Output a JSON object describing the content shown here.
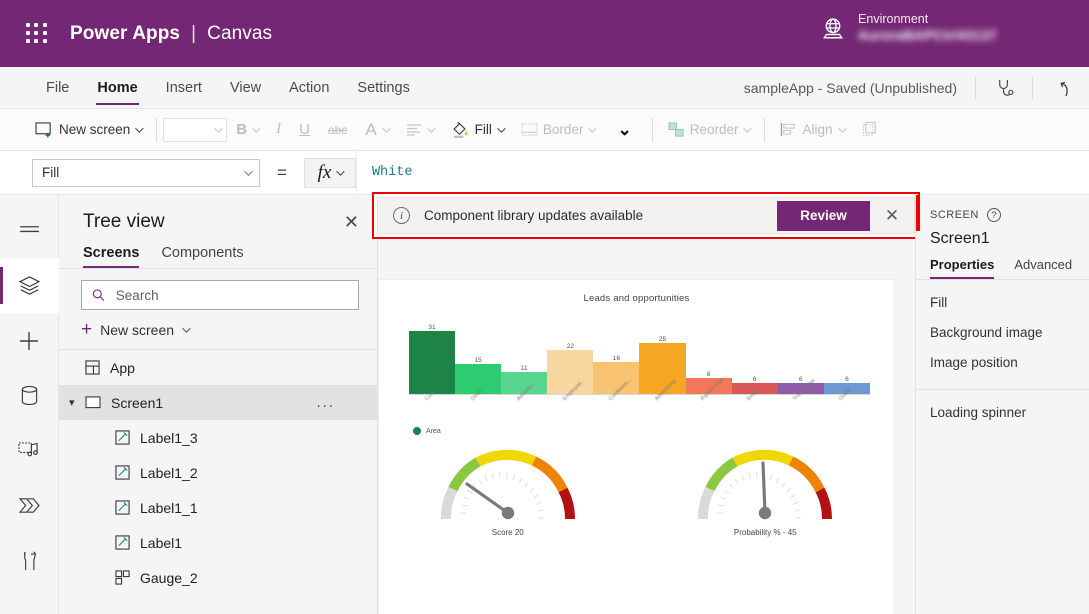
{
  "topbar": {
    "waffle_icon": "waffle-grid-icon",
    "brand": "Power Apps",
    "divider": "|",
    "product": "Canvas",
    "globe_icon": "globe-icon",
    "env_label": "Environment",
    "env_name": "AuroraBAPCtrl43137"
  },
  "menu": {
    "items": [
      {
        "label": "File",
        "active": false
      },
      {
        "label": "Home",
        "active": true
      },
      {
        "label": "Insert",
        "active": false
      },
      {
        "label": "View",
        "active": false
      },
      {
        "label": "Action",
        "active": false
      },
      {
        "label": "Settings",
        "active": false
      }
    ],
    "app_status": "sampleApp - Saved (Unpublished)",
    "checker_icon": "app-checker-stethoscope-icon",
    "undo_icon": "undo-arrow-icon"
  },
  "ribbon": {
    "new_screen": "New screen",
    "new_screen_icon": "new-screen-icon",
    "font_placeholder": "",
    "bold": "B",
    "italic": "I",
    "underline": "U",
    "strikethrough": "abc",
    "font_color_icon": "font-color-A-icon",
    "align_icon": "text-align-icon",
    "fill_icon": "fill-paint-bucket-icon",
    "fill": "Fill",
    "border_icon": "border-icon",
    "border": "Border",
    "overflow_chevron_icon": "chevron-down-icon",
    "reorder_icon": "reorder-icon",
    "reorder": "Reorder",
    "align_group_icon": "align-objects-icon",
    "align": "Align",
    "group_icon": "group-objects-icon"
  },
  "formula": {
    "property": "Fill",
    "equals": "=",
    "fx": "fx",
    "value": "White"
  },
  "rail": {
    "items": [
      {
        "icon": "hamburger-menu-icon",
        "active": false
      },
      {
        "icon": "tree-view-layers-icon",
        "active": true
      },
      {
        "icon": "insert-plus-icon",
        "active": false
      },
      {
        "icon": "data-database-icon",
        "active": false
      },
      {
        "icon": "media-icon",
        "active": false
      },
      {
        "icon": "power-automate-flow-icon",
        "active": false
      },
      {
        "icon": "variables-tools-icon",
        "active": false
      }
    ]
  },
  "treeview": {
    "title": "Tree view",
    "close_icon": "close-x-icon",
    "tabs": [
      {
        "label": "Screens",
        "active": true
      },
      {
        "label": "Components",
        "active": false
      }
    ],
    "search_icon": "search-icon",
    "search_placeholder": "Search",
    "search_value": "",
    "new_screen": "New screen",
    "new_screen_plus_icon": "plus-icon",
    "new_screen_chevron_icon": "chevron-down-icon",
    "items": [
      {
        "label": "App",
        "icon": "app-icon",
        "indent": false,
        "selected": false,
        "caret": "",
        "overflow": ""
      },
      {
        "label": "Screen1",
        "icon": "screen-icon",
        "indent": false,
        "selected": true,
        "caret": "chevron-down-icon",
        "overflow": "..."
      },
      {
        "label": "Label1_3",
        "icon": "label-icon",
        "indent": true,
        "selected": false,
        "caret": "",
        "overflow": ""
      },
      {
        "label": "Label1_2",
        "icon": "label-icon",
        "indent": true,
        "selected": false,
        "caret": "",
        "overflow": ""
      },
      {
        "label": "Label1_1",
        "icon": "label-icon",
        "indent": true,
        "selected": false,
        "caret": "",
        "overflow": ""
      },
      {
        "label": "Label1",
        "icon": "label-icon",
        "indent": true,
        "selected": false,
        "caret": "",
        "overflow": ""
      },
      {
        "label": "Gauge_2",
        "icon": "gauge-component-icon",
        "indent": true,
        "selected": false,
        "caret": "",
        "overflow": ""
      }
    ]
  },
  "notification": {
    "info_icon": "info-circle-icon",
    "message": "Component library updates available",
    "review_label": "Review",
    "close_icon": "close-x-icon",
    "highlight_color": "#ee0000",
    "button_color": "#742774"
  },
  "properties": {
    "kind": "SCREEN",
    "help_icon": "help-question-icon",
    "name": "Screen1",
    "tabs": [
      {
        "label": "Properties",
        "active": true
      },
      {
        "label": "Advanced",
        "active": false
      }
    ],
    "rows": [
      "Fill",
      "Background image",
      "Image position"
    ],
    "rows2": [
      "Loading spinner"
    ]
  },
  "chart_data": {
    "type": "bar",
    "title": "Leads and opportunities",
    "categories": [
      "Cold",
      "Deals",
      "Advertis...",
      "Employee...",
      "Conferenc...",
      "Advertising",
      "Partner Part...",
      "Email",
      "Trade show",
      "Outlet"
    ],
    "values": [
      31,
      15,
      11,
      22,
      16,
      25,
      8,
      6,
      6,
      6
    ],
    "colors": [
      "#1d8348",
      "#2ecc71",
      "#58d68d",
      "#fad7a0",
      "#f8c471",
      "#f5a623",
      "#f1785a",
      "#d95757",
      "#8e5ba6",
      "#6f97d4"
    ],
    "legend": [
      {
        "label": "Area",
        "color": "#1d8348"
      }
    ],
    "legend_position": "bottom-left",
    "xlabel": "",
    "ylabel": "",
    "ylim": [
      0,
      35
    ],
    "grid": false,
    "data_labels": true
  },
  "gauges": [
    {
      "label": "Score   20",
      "value": 20,
      "min": 0,
      "max": 100,
      "name": "score-gauge"
    },
    {
      "label": "Probability % -  45",
      "value": 45,
      "min": 0,
      "max": 100,
      "name": "probability-gauge"
    }
  ]
}
